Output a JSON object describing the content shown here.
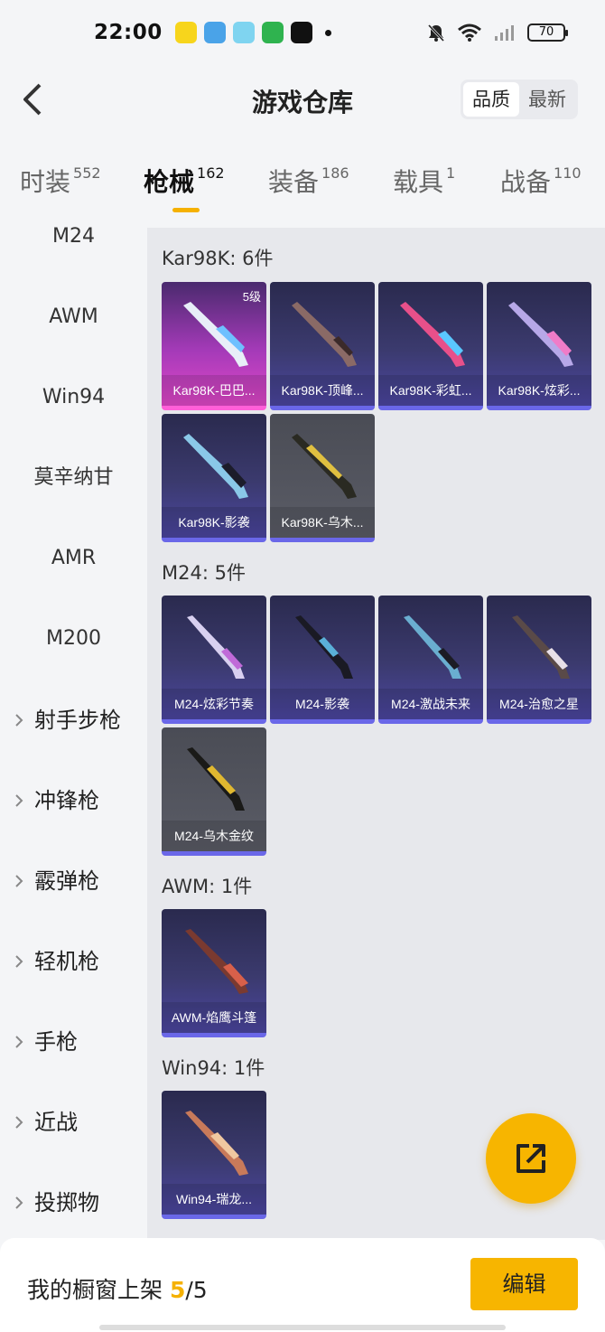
{
  "status_bar": {
    "time": "22:00",
    "battery": "70"
  },
  "header": {
    "title": "游戏仓库",
    "sort_options": [
      "品质",
      "最新"
    ],
    "sort_selected": "品质"
  },
  "tabs": [
    {
      "label": "时装",
      "count": "552"
    },
    {
      "label": "枪械",
      "count": "162",
      "active": true
    },
    {
      "label": "装备",
      "count": "186"
    },
    {
      "label": "载具",
      "count": "1"
    },
    {
      "label": "战备",
      "count": "110"
    }
  ],
  "sidebar": {
    "items": [
      "M24",
      "AWM",
      "Win94",
      "莫辛纳甘",
      "AMR",
      "M200"
    ],
    "categories": [
      "射手步枪",
      "冲锋枪",
      "霰弹枪",
      "轻机枪",
      "手枪",
      "近战",
      "投掷物"
    ]
  },
  "groups": [
    {
      "title": "Kar98K: 6件",
      "cards": [
        {
          "label": "Kar98K-巴巴...",
          "level": "5级"
        },
        {
          "label": "Kar98K-顶峰..."
        },
        {
          "label": "Kar98K-彩虹..."
        },
        {
          "label": "Kar98K-炫彩..."
        },
        {
          "label": "Kar98K-影袭"
        },
        {
          "label": "Kar98K-乌木..."
        }
      ]
    },
    {
      "title": "M24: 5件",
      "cards": [
        {
          "label": "M24-炫彩节奏"
        },
        {
          "label": "M24-影袭"
        },
        {
          "label": "M24-激战未来"
        },
        {
          "label": "M24-治愈之星"
        },
        {
          "label": "M24-乌木金纹"
        }
      ]
    },
    {
      "title": "AWM: 1件",
      "cards": [
        {
          "label": "AWM-焰鹰斗篷"
        }
      ]
    },
    {
      "title": "Win94: 1件",
      "cards": [
        {
          "label": "Win94-瑞龙..."
        }
      ]
    }
  ],
  "bottom": {
    "shelf_label": "我的橱窗上架",
    "shelf_current": "5",
    "shelf_total": "/5",
    "edit_label": "编辑"
  },
  "colors": {
    "accent": "#f7b500",
    "card_purple": "#3b3a6e",
    "card_pink": "#e048c8",
    "card_gray": "#5a5c66"
  },
  "icons": {
    "back": "chevron-left-icon",
    "fab": "share-out-icon",
    "sidebar_chevron": "chevron-right-icon"
  }
}
